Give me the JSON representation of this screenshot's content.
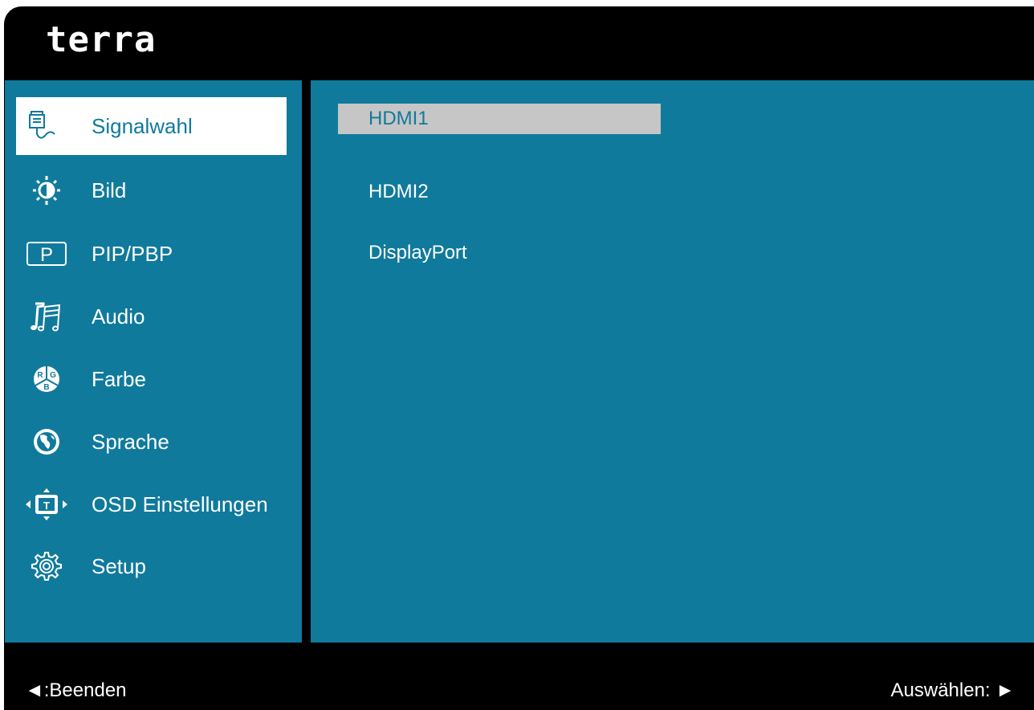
{
  "brand": "terra",
  "menu": {
    "items": [
      {
        "label": "Signalwahl",
        "icon": "signal-input-icon",
        "selected": true
      },
      {
        "label": "Bild",
        "icon": "brightness-icon"
      },
      {
        "label": "PIP/PBP",
        "icon": "pip-icon"
      },
      {
        "label": "Audio",
        "icon": "music-notes-icon"
      },
      {
        "label": "Farbe",
        "icon": "rgb-color-icon"
      },
      {
        "label": "Sprache",
        "icon": "globe-icon"
      },
      {
        "label": "OSD Einstellungen",
        "icon": "osd-position-icon"
      },
      {
        "label": "Setup",
        "icon": "gear-icon"
      }
    ]
  },
  "sources": {
    "items": [
      {
        "label": "HDMI1",
        "selected": true
      },
      {
        "label": "HDMI2"
      },
      {
        "label": "DisplayPort"
      }
    ]
  },
  "footer": {
    "left": "◄:Beenden",
    "right": "Auswählen: ►"
  },
  "colors": {
    "panel": "#107a9c",
    "frame": "#000000",
    "highlight_menu": "#ffffff",
    "highlight_source": "#c6c6c6"
  }
}
